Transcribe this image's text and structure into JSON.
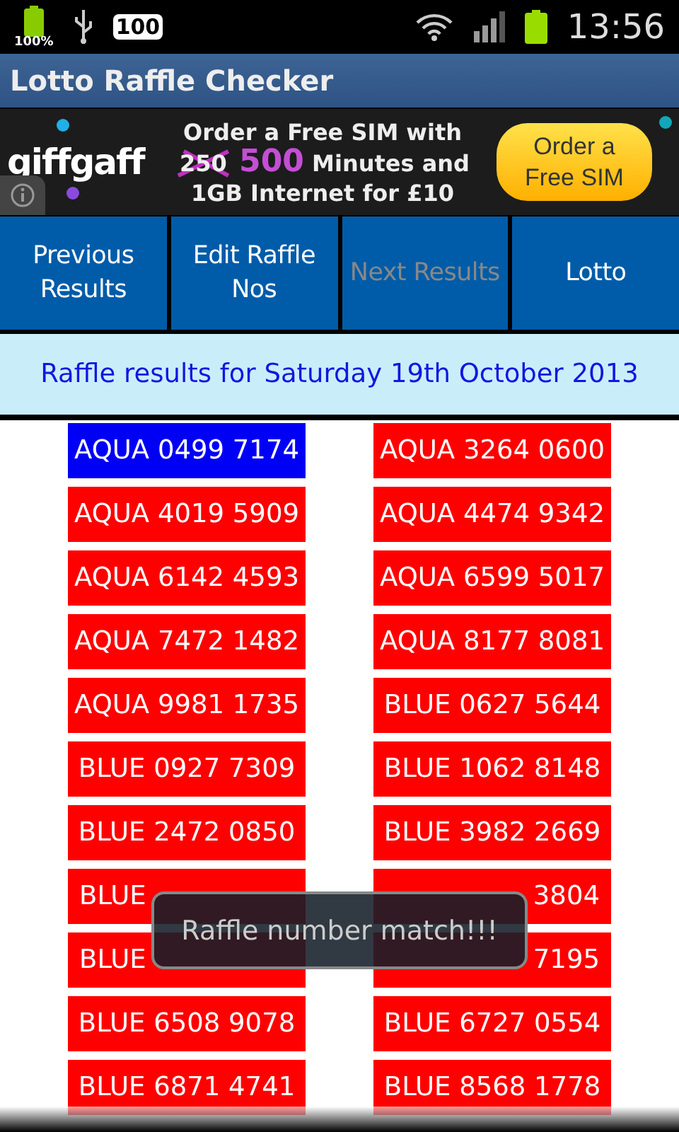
{
  "status_bar": {
    "battery_percent": "100%",
    "badge": "100",
    "time": "13:56"
  },
  "title_bar": {
    "title": "Lotto Raffle Checker"
  },
  "ad": {
    "brand": "giffgaff",
    "line1": "Order a Free SIM with",
    "old_minutes": "250",
    "minutes": "500",
    "line2_rest": "Minutes and",
    "line3": "1GB Internet for £10",
    "cta": "Order a Free SIM"
  },
  "buttons": [
    {
      "label": "Previous Results",
      "disabled": false
    },
    {
      "label": "Edit Raffle Nos",
      "disabled": false
    },
    {
      "label": "Next Results",
      "disabled": true
    },
    {
      "label": "Lotto",
      "disabled": false
    }
  ],
  "heading": "Raffle results for Saturday 19th October 2013",
  "tickets": [
    {
      "number": "AQUA 0499 7174",
      "matched": true
    },
    {
      "number": "AQUA 3264 0600",
      "matched": false
    },
    {
      "number": "AQUA 4019 5909",
      "matched": false
    },
    {
      "number": "AQUA 4474 9342",
      "matched": false
    },
    {
      "number": "AQUA 6142 4593",
      "matched": false
    },
    {
      "number": "AQUA 6599 5017",
      "matched": false
    },
    {
      "number": "AQUA 7472 1482",
      "matched": false
    },
    {
      "number": "AQUA 8177 8081",
      "matched": false
    },
    {
      "number": "AQUA 9981 1735",
      "matched": false
    },
    {
      "number": "BLUE 0627 5644",
      "matched": false
    },
    {
      "number": "BLUE 0927 7309",
      "matched": false
    },
    {
      "number": "BLUE 1062 8148",
      "matched": false
    },
    {
      "number": "BLUE 2472 0850",
      "matched": false
    },
    {
      "number": "BLUE 3982 2669",
      "matched": false
    },
    {
      "number": "BLUE",
      "matched": false,
      "kind": "head"
    },
    {
      "number": "3804",
      "matched": false,
      "kind": "tail"
    },
    {
      "number": "BLUE",
      "matched": false,
      "kind": "head"
    },
    {
      "number": "7195",
      "matched": false,
      "kind": "tail"
    },
    {
      "number": "BLUE 6508 9078",
      "matched": false
    },
    {
      "number": "BLUE 6727 0554",
      "matched": false
    },
    {
      "number": "BLUE 6871 4741",
      "matched": false
    },
    {
      "number": "BLUE 8568 1778",
      "matched": false
    }
  ],
  "toast": "Raffle number match!!!"
}
